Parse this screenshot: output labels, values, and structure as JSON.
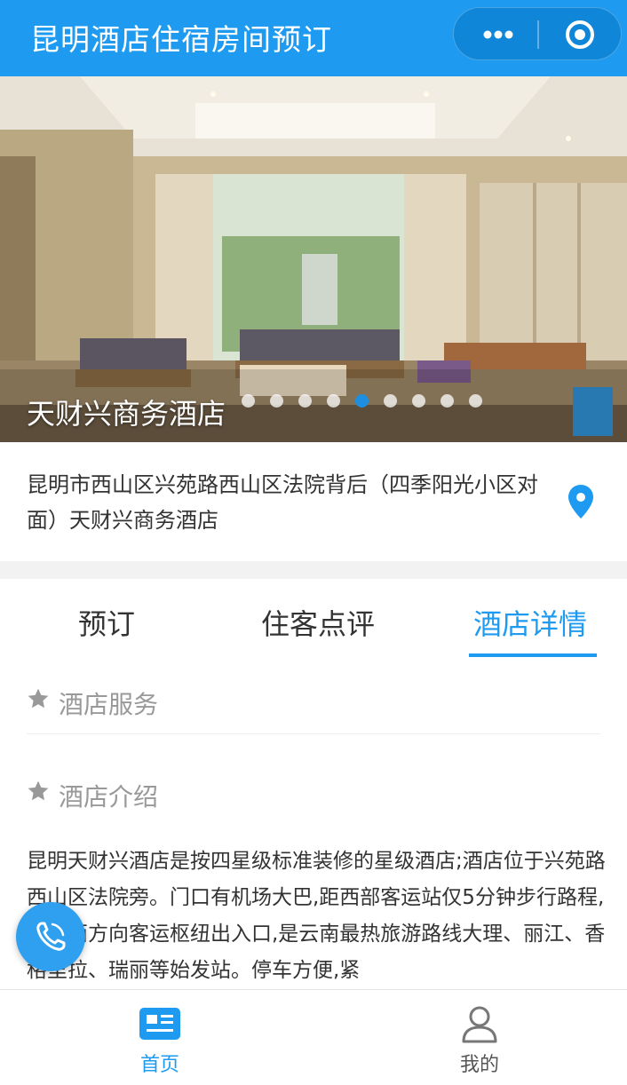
{
  "header": {
    "title": "昆明酒店住宿房间预订",
    "more_icon": "more-dots-icon",
    "close_icon": "target-circle-icon"
  },
  "banner": {
    "hotel_name": "天财兴商务酒店",
    "slide_count": 9,
    "active_slide": 5
  },
  "address": {
    "text": "昆明市西山区兴苑路西山区法院背后（四季阳光小区对面）天财兴商务酒店",
    "icon": "location-pin-icon"
  },
  "tabs": [
    {
      "label": "预订"
    },
    {
      "label": "住客点评"
    },
    {
      "label": "酒店详情"
    }
  ],
  "active_tab": "酒店详情",
  "sections": {
    "services": {
      "title": "酒店服务",
      "icon": "star-icon"
    },
    "intro": {
      "title": "酒店介绍",
      "icon": "star-icon",
      "body": "昆明天财兴酒店是按四星级标准装修的星级酒店;酒店位于兴苑路西山区法院旁。门口有机场大巴,距西部客运站仅5分钟步行路程,是滇西方向客运枢纽出入口,是云南最热旅游路线大理、丽江、香格里拉、瑞丽等始发站。停车方便,紧"
    }
  },
  "floating": {
    "icon": "phone-icon"
  },
  "bottom_nav": [
    {
      "label": "首页",
      "icon": "home-card-icon"
    },
    {
      "label": "我的",
      "icon": "user-icon"
    }
  ],
  "colors": {
    "brand": "#1e9bf0",
    "text": "#333333",
    "muted": "#999999"
  }
}
